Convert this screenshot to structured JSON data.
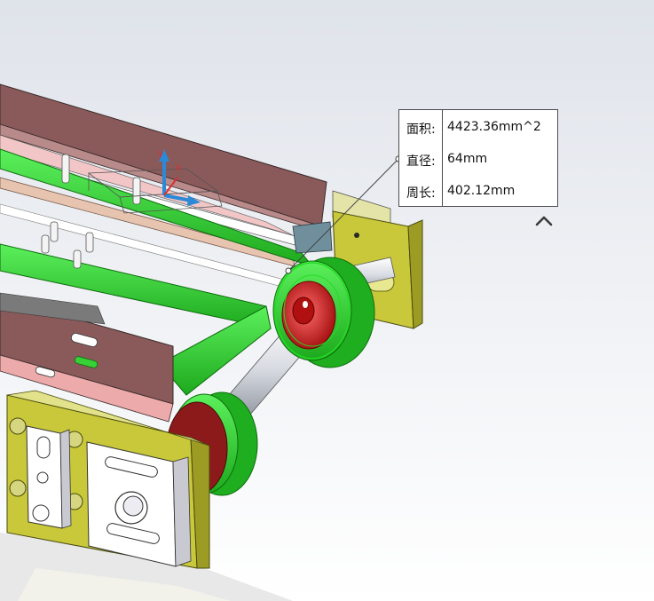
{
  "measure": {
    "rows": [
      {
        "label": "面积:",
        "value": "4423.36mm^2"
      },
      {
        "label": "直径:",
        "value": "64mm"
      },
      {
        "label": "周长:",
        "value": "402.12mm"
      }
    ]
  },
  "triad": {
    "x_label": "x",
    "y_label": "y"
  },
  "icons": {
    "collapse": "chevron-up-icon"
  },
  "colors": {
    "rail_brown": "#8a5a5a",
    "belt_green": "#37d137",
    "bracket_yellow": "#c8c83a",
    "pulley_red": "#c81e1e",
    "selection_green": "#22dd22"
  }
}
